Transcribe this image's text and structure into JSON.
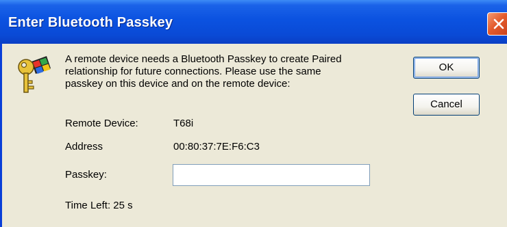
{
  "window": {
    "title": "Enter Bluetooth Passkey"
  },
  "icons": {
    "key": "key-security-icon",
    "close": "close-icon"
  },
  "message": {
    "line1": "A remote device needs a Bluetooth Passkey to create Paired",
    "line2": "relationship for future connections. Please use the same",
    "line3": "passkey on this device and on the remote device:"
  },
  "fields": {
    "remote_device_label": "Remote Device:",
    "remote_device_value": "T68i",
    "address_label": "Address",
    "address_value": "00:80:37:7E:F6:C3",
    "passkey_label": "Passkey:",
    "passkey_value": "",
    "time_left": "Time Left: 25 s"
  },
  "buttons": {
    "ok": "OK",
    "cancel": "Cancel"
  },
  "colors": {
    "titlebar": "#0b52e0",
    "client_bg": "#ece9d8",
    "close_button": "#e35b2c"
  }
}
